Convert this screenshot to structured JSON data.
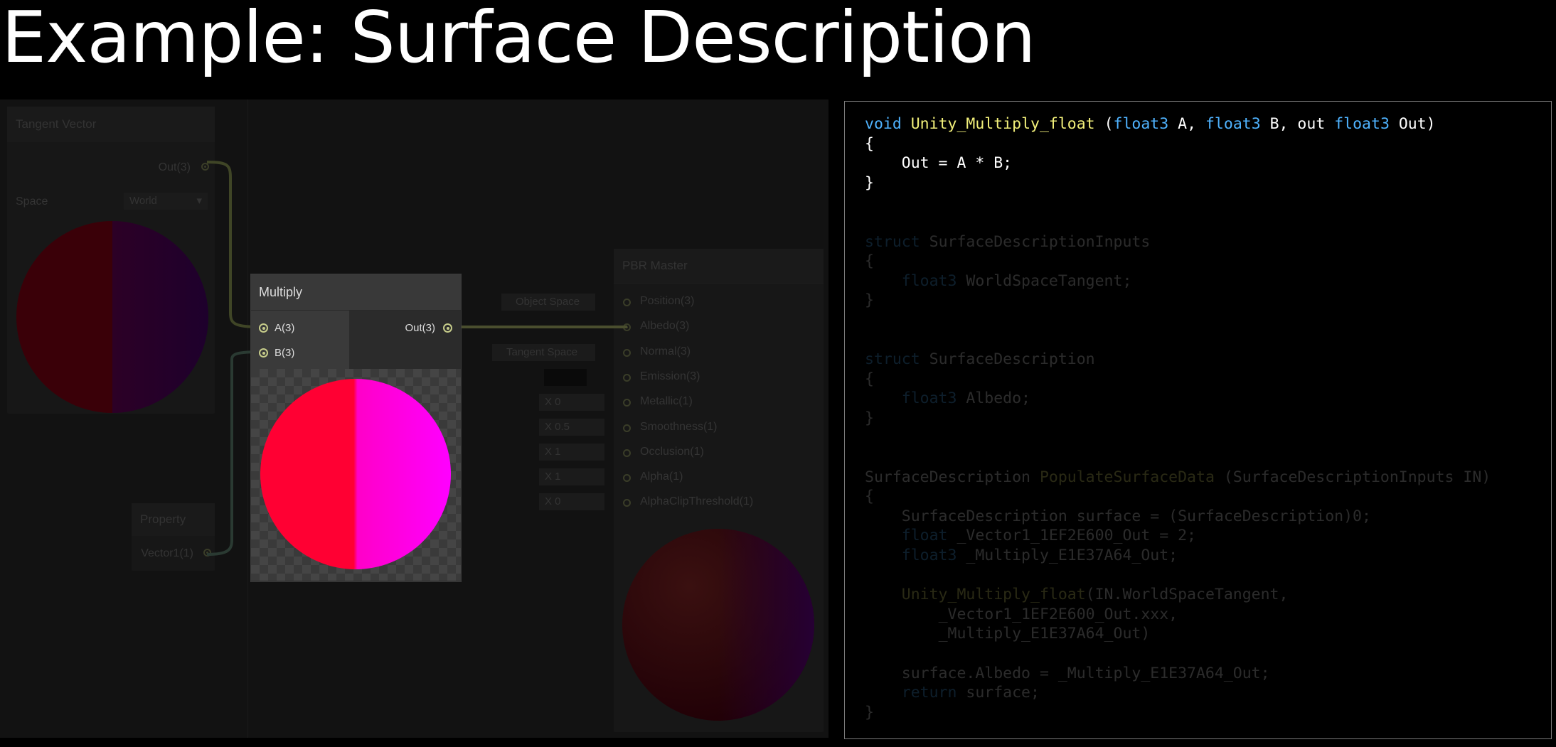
{
  "slide": {
    "title": "Example: Surface Description"
  },
  "graph": {
    "tangent_node": {
      "title": "Tangent Vector",
      "output_port": "Out(3)",
      "space_label": "Space",
      "space_value": "World"
    },
    "multiply_node": {
      "title": "Multiply",
      "input_a": "A(3)",
      "input_b": "B(3)",
      "output": "Out(3)"
    },
    "property_node": {
      "title": "Property",
      "output_port": "Vector1(1)"
    },
    "master_node": {
      "title": "PBR Master",
      "ports": [
        "Position(3)",
        "Albedo(3)",
        "Normal(3)",
        "Emission(3)",
        "Metallic(1)",
        "Smoothness(1)",
        "Occlusion(1)",
        "Alpha(1)",
        "AlphaClipThreshold(1)"
      ],
      "inputs": {
        "position": "Object Space",
        "normal": "Tangent Space",
        "metallic": "X 0",
        "smoothness": "X 0.5",
        "occlusion": "X 1",
        "alpha": "X 1",
        "alpha_clip": "X 0"
      }
    },
    "colors": {
      "preview_red": "#ff0033",
      "preview_magenta": "#ff00ff",
      "wire": "#c6cc8a"
    }
  },
  "code": {
    "func_void": "void",
    "func_name": "Unity_Multiply_float",
    "func_params": "(float3 A, float3 B, out float3 Out)",
    "func_open": "{",
    "func_body": "Out = A * B;",
    "func_close": "}",
    "s1_kw": "struct",
    "s1_name": "SurfaceDescriptionInputs",
    "s1_field": "float3 WorldSpaceTangent;",
    "s2_kw": "struct",
    "s2_name": "SurfaceDescription",
    "s2_field": "float3 Albedo;",
    "populate_type": "SurfaceDescription",
    "populate_name": "PopulateSurfaceData",
    "populate_params": "(SurfaceDescriptionInputs IN)",
    "l_surface": "SurfaceDescription surface = (SurfaceDescription)0;",
    "l_vec": "float _Vector1_1EF2E600_Out = 2;",
    "l_mul": "float3 _Multiply_E1E37A64_Out;",
    "l_call1": "Unity_Multiply_float(IN.WorldSpaceTangent,",
    "l_call2": "_Vector1_1EF2E600_Out.xxx,",
    "l_call3": "_Multiply_E1E37A64_Out)",
    "l_assign": "surface.Albedo = _Multiply_E1E37A64_Out;",
    "l_return": "return surface;"
  }
}
